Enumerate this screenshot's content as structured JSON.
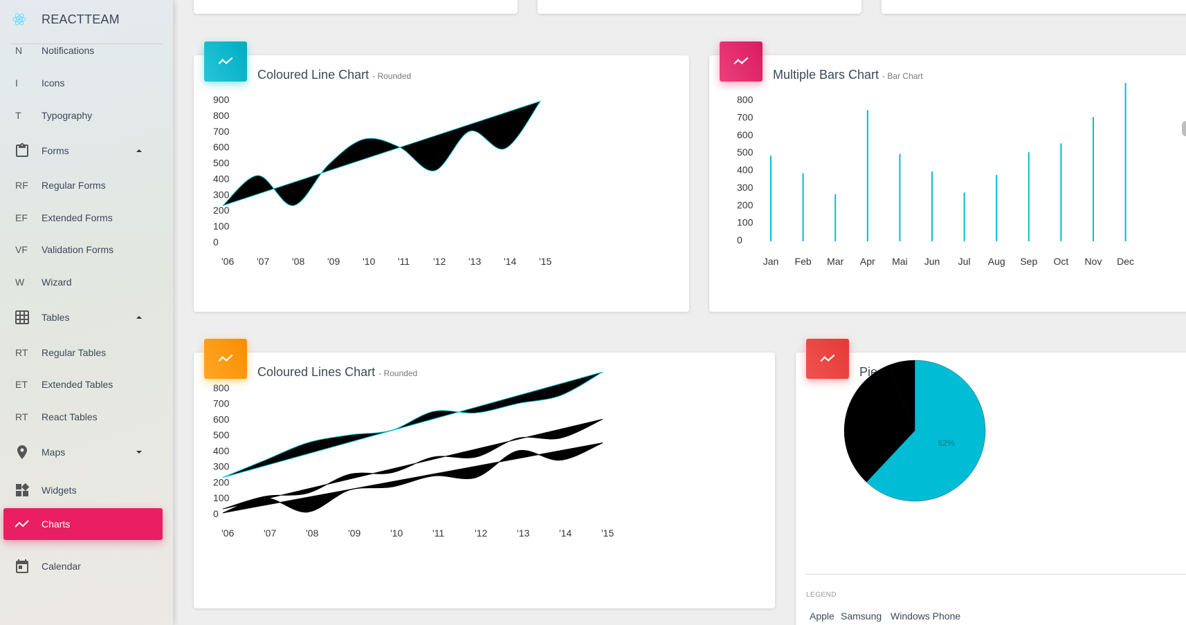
{
  "brand": {
    "title": "REACTTEAM"
  },
  "sidebar": {
    "items": [
      {
        "mini": "N",
        "label": "Notifications"
      },
      {
        "mini": "I",
        "label": "Icons"
      },
      {
        "mini": "T",
        "label": "Typography"
      },
      {
        "icon": "clipboard-icon",
        "label": "Forms",
        "caret": "up"
      },
      {
        "mini": "RF",
        "label": "Regular Forms"
      },
      {
        "mini": "EF",
        "label": "Extended Forms"
      },
      {
        "mini": "VF",
        "label": "Validation Forms"
      },
      {
        "mini": "W",
        "label": "Wizard"
      },
      {
        "icon": "grid-icon",
        "label": "Tables",
        "caret": "up"
      },
      {
        "mini": "RT",
        "label": "Regular Tables"
      },
      {
        "mini": "ET",
        "label": "Extended Tables"
      },
      {
        "mini": "RT",
        "label": "React Tables"
      },
      {
        "icon": "place-icon",
        "label": "Maps",
        "caret": "down"
      },
      {
        "icon": "widgets-icon",
        "label": "Widgets"
      },
      {
        "icon": "timeline-icon",
        "label": "Charts",
        "active": true
      },
      {
        "icon": "calendar-icon",
        "label": "Calendar"
      }
    ]
  },
  "colors": {
    "info": "#00bcd4",
    "rose": "#e91e63",
    "warning": "#ff9800",
    "danger": "#f44336",
    "active": "#e91e63"
  },
  "cards": {
    "line": {
      "title": "Coloured Line Chart",
      "subtitle": "- Rounded"
    },
    "bars": {
      "title": "Multiple Bars Chart",
      "subtitle": "- Bar Chart"
    },
    "lines": {
      "title": "Coloured Lines Chart",
      "subtitle": "- Rounded"
    },
    "pie": {
      "title": "Pie Chart",
      "legend_header": "LEGEND",
      "legend": [
        "Apple",
        "Samsung",
        "Windows Phone"
      ]
    }
  },
  "chart_data": [
    {
      "type": "line",
      "title": "Coloured Line Chart",
      "x": [
        "'06",
        "'07",
        "'08",
        "'09",
        "'10",
        "'11",
        "'12",
        "'13",
        "'14",
        "'15"
      ],
      "series": [
        {
          "values": [
            230,
            420,
            230,
            490,
            650,
            600,
            450,
            700,
            590,
            890
          ]
        }
      ],
      "yticks": [
        0,
        100,
        200,
        300,
        400,
        500,
        600,
        700,
        800,
        900
      ],
      "ylim": [
        0,
        900
      ]
    },
    {
      "type": "bar",
      "title": "Multiple Bars Chart",
      "categories": [
        "Jan",
        "Feb",
        "Mar",
        "Apr",
        "Mai",
        "Jun",
        "Jul",
        "Aug",
        "Sep",
        "Oct",
        "Nov",
        "Dec"
      ],
      "values": [
        480,
        380,
        260,
        740,
        490,
        390,
        270,
        370,
        500,
        550,
        700,
        895
      ],
      "yticks": [
        0,
        100,
        200,
        300,
        400,
        500,
        600,
        700,
        800
      ],
      "ylim": [
        0,
        800
      ]
    },
    {
      "type": "line",
      "title": "Coloured Lines Chart",
      "x": [
        "'06",
        "'07",
        "'08",
        "'09",
        "'10",
        "'11",
        "'12",
        "'13",
        "'14",
        "'15"
      ],
      "series": [
        {
          "values": [
            230,
            340,
            450,
            500,
            530,
            650,
            640,
            700,
            750,
            900
          ]
        },
        {
          "values": [
            30,
            110,
            130,
            250,
            260,
            360,
            360,
            480,
            480,
            600
          ]
        },
        {
          "values": [
            5,
            100,
            10,
            150,
            170,
            240,
            230,
            400,
            340,
            450
          ]
        }
      ],
      "yticks": [
        0,
        100,
        200,
        300,
        400,
        500,
        600,
        700,
        800,
        900
      ],
      "ylim": [
        0,
        900
      ]
    },
    {
      "type": "pie",
      "title": "Pie Chart",
      "categories": [
        "Apple",
        "Samsung",
        "Windows Phone"
      ],
      "values": [
        62,
        32,
        6
      ],
      "labels": [
        "62%",
        "",
        ""
      ]
    }
  ]
}
